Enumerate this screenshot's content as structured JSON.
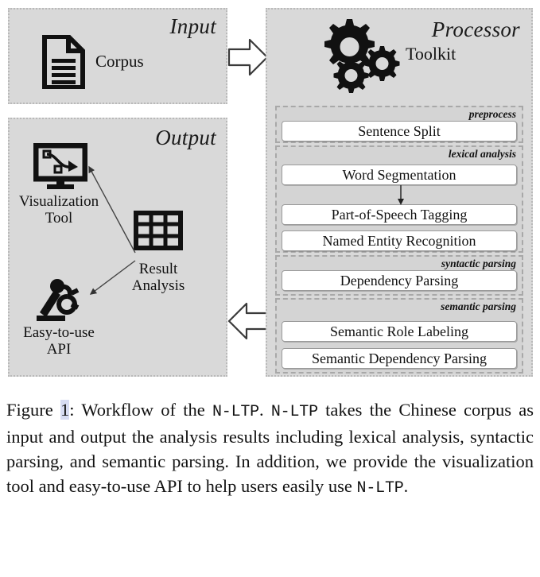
{
  "figure": {
    "input": {
      "title": "Input",
      "icon": "document-icon",
      "item_label": "Corpus"
    },
    "output": {
      "title": "Output",
      "items": [
        {
          "icon": "monitor-chart-icon",
          "label": "Visualization\nTool"
        },
        {
          "icon": "robot-arm-icon",
          "label": "Easy-to-use\nAPI"
        },
        {
          "icon": "table-grid-icon",
          "label": "Result\nAnalysis"
        }
      ],
      "visualization_label_line1": "Visualization",
      "visualization_label_line2": "Tool",
      "api_label_line1": "Easy-to-use",
      "api_label_line2": "API",
      "result_label_line1": "Result",
      "result_label_line2": "Analysis"
    },
    "processor": {
      "title": "Processor",
      "icon": "gears-icon",
      "subtitle": "Toolkit",
      "groups": [
        {
          "label": "preprocess",
          "modules": [
            "Sentence Split"
          ]
        },
        {
          "label": "lexical analysis",
          "modules": [
            "Word Segmentation",
            "Part-of-Speech Tagging",
            "Named Entity Recognition"
          ]
        },
        {
          "label": "syntactic parsing",
          "modules": [
            "Dependency Parsing"
          ]
        },
        {
          "label": "semantic parsing",
          "modules": [
            "Semantic Role Labeling",
            "Semantic Dependency Parsing"
          ]
        }
      ]
    },
    "arrows": {
      "input_to_processor": "arrow-right-icon",
      "processor_to_output": "arrow-left-icon",
      "word_seg_to_pos": "arrow-down-icon",
      "result_to_visualization": "arrow-pointer-icon",
      "result_to_api": "arrow-pointer-icon"
    },
    "colors": {
      "panel_fill": "#d9d9d9",
      "panel_border": "#b9b9b9",
      "group_fill": "#d4d4d4",
      "group_border": "#a8a8a8",
      "module_fill": "#ffffff",
      "module_border": "#9a9a9a",
      "icon_color": "#111111",
      "figref_highlight": "#d7dcf2"
    }
  },
  "caption": {
    "prefix": "Figure ",
    "number": "1",
    "after_number": ": Workflow of the ",
    "mono1": "N-LTP",
    "mid1": ". ",
    "mono2": "N-LTP",
    "body": " takes the Chinese corpus as input and output the analysis results including lexical analysis, syntactic parsing, and semantic parsing. In addition, we provide the visualization tool and easy-to-use API to help users easily use ",
    "mono3": "N-LTP",
    "suffix": "."
  }
}
